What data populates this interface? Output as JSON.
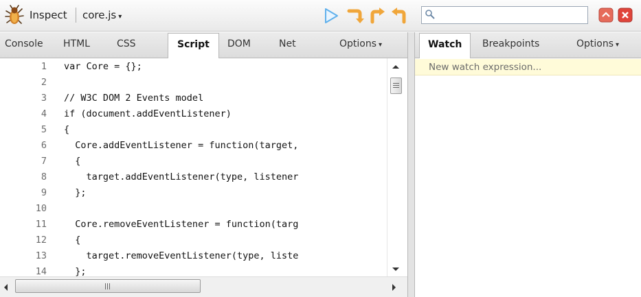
{
  "toolbar": {
    "inspect_label": "Inspect",
    "file_label": "core.js",
    "file_caret": "▾",
    "search": {
      "value": "",
      "placeholder": ""
    },
    "icons": [
      "firebug-icon",
      "continue-icon",
      "step-over-icon",
      "step-into-icon",
      "step-out-icon",
      "search-icon",
      "minimize-icon",
      "close-icon"
    ]
  },
  "left_tabs": {
    "items": [
      "Console",
      "HTML",
      "CSS",
      "Script",
      "DOM",
      "Net"
    ],
    "active": "Script",
    "options_label": "Options",
    "options_caret": "▾"
  },
  "code": {
    "lines": [
      {
        "n": "1",
        "text": "var Core = {};"
      },
      {
        "n": "2",
        "text": ""
      },
      {
        "n": "3",
        "text": "// W3C DOM 2 Events model"
      },
      {
        "n": "4",
        "text": "if (document.addEventListener)"
      },
      {
        "n": "5",
        "text": "{"
      },
      {
        "n": "6",
        "text": "  Core.addEventListener = function(target,"
      },
      {
        "n": "7",
        "text": "  {"
      },
      {
        "n": "8",
        "text": "    target.addEventListener(type, listener"
      },
      {
        "n": "9",
        "text": "  };"
      },
      {
        "n": "10",
        "text": ""
      },
      {
        "n": "11",
        "text": "  Core.removeEventListener = function(targ"
      },
      {
        "n": "12",
        "text": "  {"
      },
      {
        "n": "13",
        "text": "    target.removeEventListener(type, liste"
      },
      {
        "n": "14",
        "text": "  };"
      }
    ]
  },
  "right_tabs": {
    "items": [
      "Watch",
      "Breakpoints"
    ],
    "active": "Watch",
    "options_label": "Options",
    "options_caret": "▾"
  },
  "watch": {
    "new_expression": "New watch expression..."
  },
  "colors": {
    "toolbar_bg": "#efefef",
    "tab_bg": "#e3e3e3",
    "watch_bg": "#fffbd9",
    "debug_continue": "#6fb6ee",
    "debug_step": "#f3a93b",
    "window_button": "#e0443a"
  }
}
